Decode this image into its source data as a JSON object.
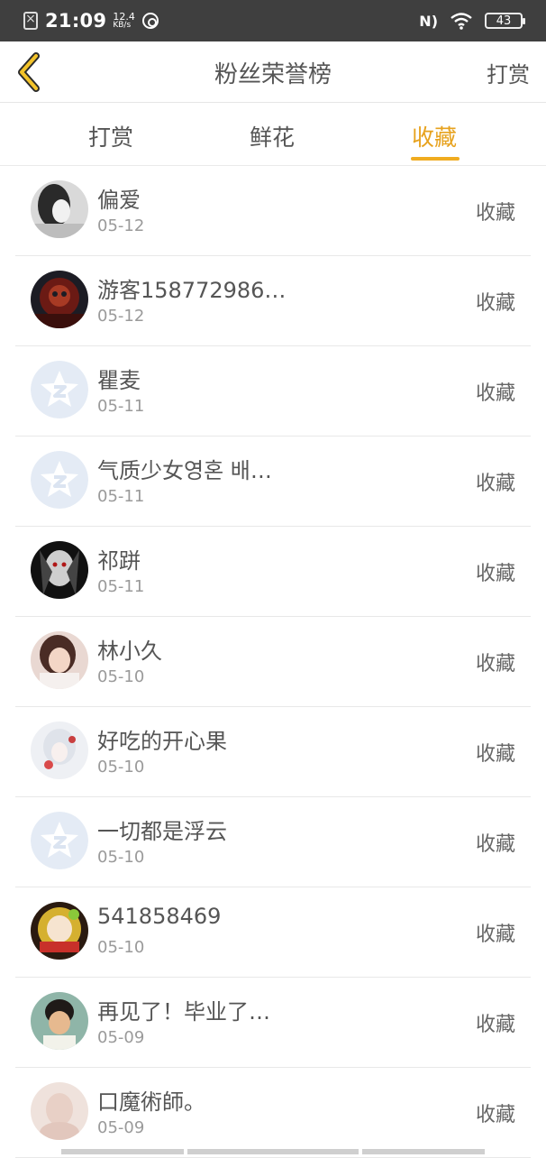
{
  "status_bar": {
    "time": "21:09",
    "speed_value": "12.4",
    "speed_unit": "KB/s",
    "battery": "43"
  },
  "header": {
    "title": "粉丝荣誉榜",
    "action_label": "打赏"
  },
  "tabs": [
    {
      "label": "打赏",
      "active": false
    },
    {
      "label": "鲜花",
      "active": false
    },
    {
      "label": "收藏",
      "active": true
    }
  ],
  "accent_color": "#f0ac20",
  "list": [
    {
      "name": "偏爱",
      "date": "05-12",
      "action": "收藏",
      "avatar": "photo-girl-bw"
    },
    {
      "name": "游客158772986…",
      "date": "05-12",
      "action": "收藏",
      "avatar": "photo-dark-red"
    },
    {
      "name": "瞿麦",
      "date": "05-11",
      "action": "收藏",
      "avatar": "default-star"
    },
    {
      "name": "气质少女영혼 배…",
      "date": "05-11",
      "action": "收藏",
      "avatar": "default-star"
    },
    {
      "name": "祁跰",
      "date": "05-11",
      "action": "收藏",
      "avatar": "photo-anime-dark"
    },
    {
      "name": "林小久",
      "date": "05-10",
      "action": "收藏",
      "avatar": "photo-girl-pink"
    },
    {
      "name": "好吃的开心果",
      "date": "05-10",
      "action": "收藏",
      "avatar": "photo-anime-light"
    },
    {
      "name": "一切都是浮云",
      "date": "05-10",
      "action": "收藏",
      "avatar": "default-star"
    },
    {
      "name": "541858469",
      "date": "05-10",
      "action": "收藏",
      "avatar": "photo-anime-colorful"
    },
    {
      "name": "再见了！毕业了…",
      "date": "05-09",
      "action": "收藏",
      "avatar": "photo-kid"
    },
    {
      "name": "口魔術師。",
      "date": "05-09",
      "action": "收藏",
      "avatar": "photo-faded"
    }
  ]
}
